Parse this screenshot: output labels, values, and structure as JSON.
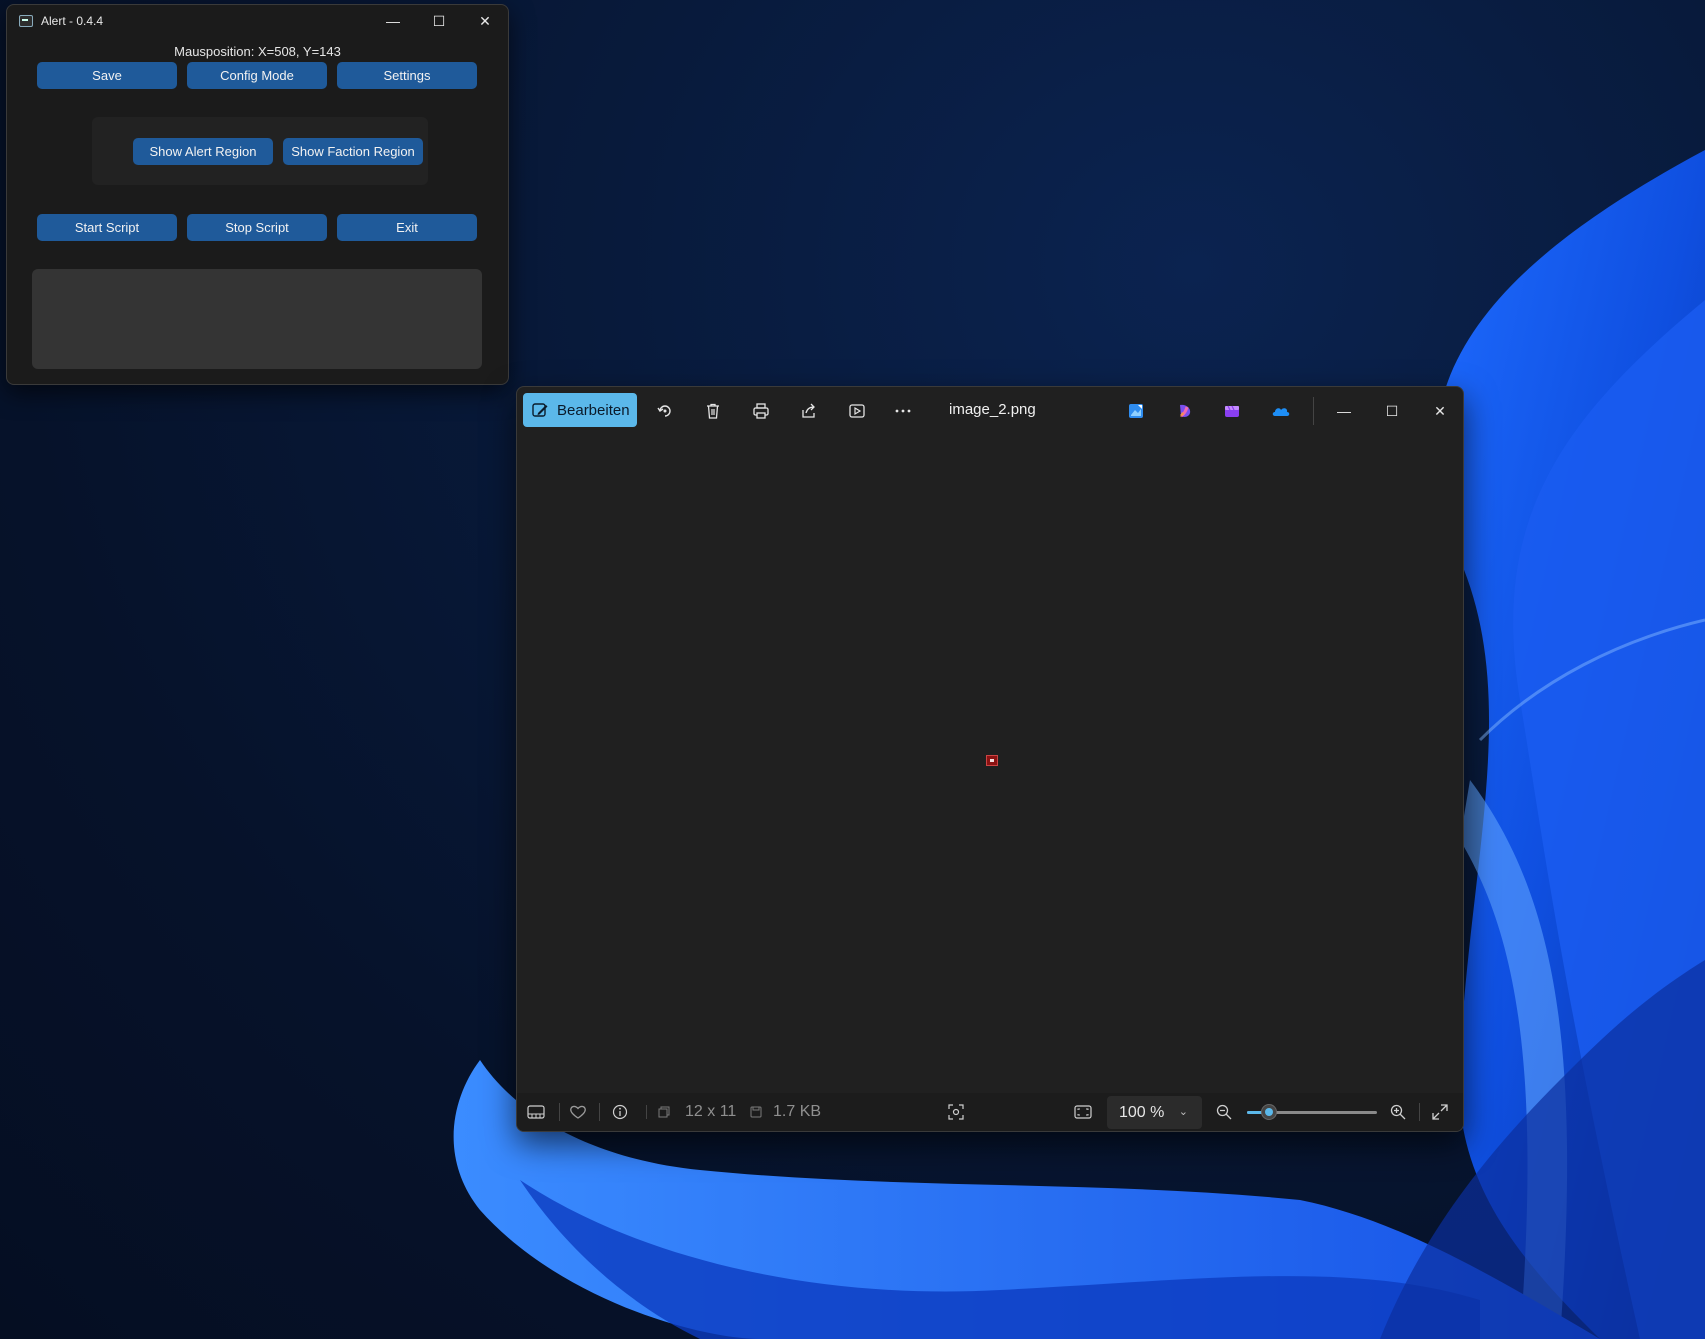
{
  "alert_window": {
    "title": "Alert - 0.4.4",
    "mouse_position": "Mausposition: X=508, Y=143",
    "buttons": {
      "save": "Save",
      "config_mode": "Config Mode",
      "settings": "Settings",
      "show_alert_region": "Show Alert Region",
      "show_faction_region": "Show Faction Region",
      "start_script": "Start Script",
      "stop_script": "Stop Script",
      "exit": "Exit"
    },
    "window_controls": {
      "minimize": "—",
      "maximize": "☐",
      "close": "✕"
    }
  },
  "photos_window": {
    "edit_label": "Bearbeiten",
    "filename": "image_2.png",
    "toolbar_icons": [
      "rotate-icon",
      "delete-icon",
      "print-icon",
      "share-icon",
      "slideshow-icon",
      "more-icon"
    ],
    "app_icons": [
      "edit-image-icon",
      "designer-icon",
      "clipchamp-icon",
      "onedrive-icon"
    ],
    "window_controls": {
      "minimize": "—",
      "maximize": "☐",
      "close": "✕"
    },
    "status": {
      "dimensions": "12 x 11",
      "file_size": "1.7 KB",
      "zoom": "100 %",
      "zoom_slider_fraction": 0.17
    },
    "colors": {
      "accent": "#5bb8ea",
      "image_pixel": "#8b1212"
    }
  }
}
